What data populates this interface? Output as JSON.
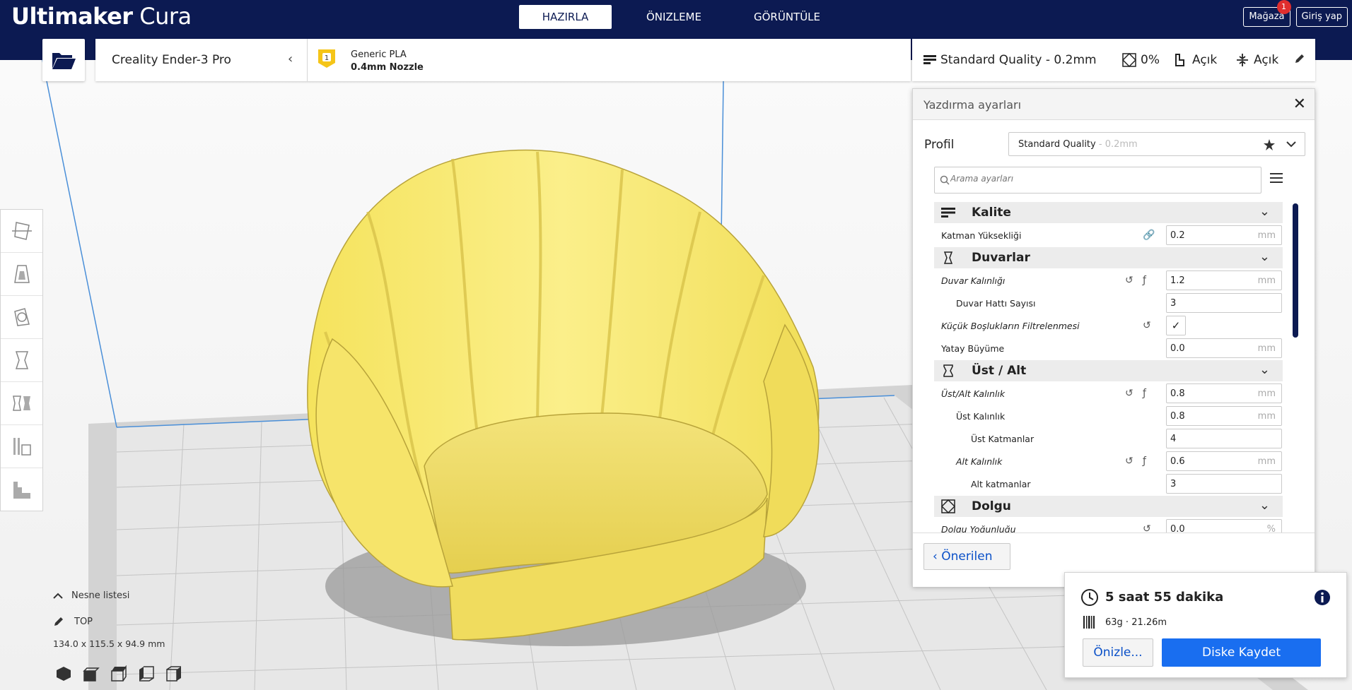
{
  "app": {
    "logo_bold": "Ultimaker",
    "logo_light": " Cura"
  },
  "stages": [
    "HAZIRLA",
    "ÖNIZLEME",
    "GÖRÜNTÜLE"
  ],
  "header": {
    "marketplace": "Mağaza",
    "marketplace_badge": "1",
    "signin": "Giriş yap"
  },
  "machine": {
    "printer": "Creality Ender-3 Pro",
    "extruder_number": "1",
    "material": "Generic PLA",
    "nozzle": "0.4mm Nozzle"
  },
  "print_setup": {
    "profile": "Standard Quality - 0.2mm",
    "infill": "0%",
    "support": "Açık",
    "adhesion": "Açık"
  },
  "panel": {
    "title": "Yazdırma ayarları",
    "profile_label": "Profil",
    "profile_value": "Standard Quality",
    "profile_suffix": " - 0.2mm",
    "search_placeholder": "Arama ayarları",
    "recommended": "Önerilen"
  },
  "categories": {
    "quality": "Kalite",
    "walls": "Duvarlar",
    "topbottom": "Üst / Alt",
    "infill": "Dolgu"
  },
  "settings": {
    "layer_height": {
      "label": "Katman Yüksekliği",
      "value": "0.2",
      "unit": "mm"
    },
    "wall_thickness": {
      "label": "Duvar Kalınlığı",
      "value": "1.2",
      "unit": "mm"
    },
    "wall_line_count": {
      "label": "Duvar Hattı Sayısı",
      "value": "3"
    },
    "filter_gaps": {
      "label": "Küçük Boşlukların Filtrelenmesi",
      "checked": "✓"
    },
    "horizontal_expansion": {
      "label": "Yatay Büyüme",
      "value": "0.0",
      "unit": "mm"
    },
    "topbottom_thickness": {
      "label": "Üst/Alt Kalınlık",
      "value": "0.8",
      "unit": "mm"
    },
    "top_thickness": {
      "label": "Üst Kalınlık",
      "value": "0.8",
      "unit": "mm"
    },
    "top_layers": {
      "label": "Üst Katmanlar",
      "value": "4"
    },
    "bottom_thickness": {
      "label": "Alt Kalınlık",
      "value": "0.6",
      "unit": "mm"
    },
    "bottom_layers": {
      "label": "Alt katmanlar",
      "value": "3"
    },
    "infill_density": {
      "label": "Dolgu Yoğunluğu",
      "value": "0.0",
      "unit": "%"
    }
  },
  "estimate": {
    "time": "5 saat 55 dakika",
    "material": "63g · 21.26m",
    "preview": "Önizle...",
    "save": "Diske Kaydet"
  },
  "object": {
    "list_label": "Nesne listesi",
    "name": "TOP",
    "dims": "134.0 x 115.5 x 94.9 mm"
  },
  "colors": {
    "header": "#0c1a52",
    "accent": "#196ef0",
    "model": "#f8e86a",
    "link": "#0a50c8"
  },
  "icons": [
    "folder-open-icon",
    "extruder-icon",
    "profile-icon",
    "infill-icon",
    "support-icon",
    "adhesion-icon",
    "edit-icon",
    "star-icon",
    "chevron-down-icon",
    "search-icon",
    "menu-icon",
    "link-icon",
    "reset-icon",
    "function-icon",
    "clock-icon",
    "info-icon",
    "spool-icon"
  ]
}
